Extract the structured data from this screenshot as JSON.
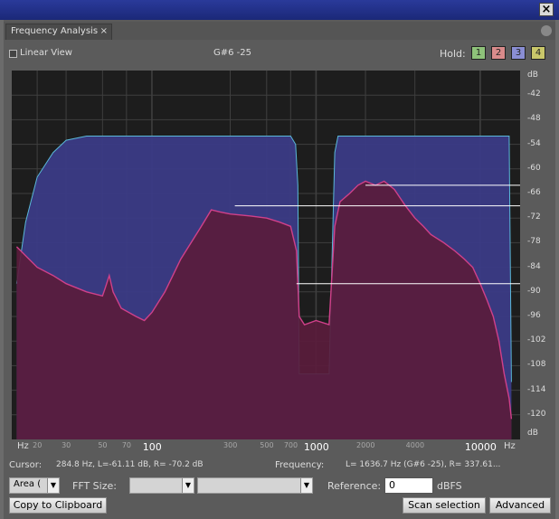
{
  "window": {
    "close_glyph": "×"
  },
  "tab": {
    "title": "Frequency Analysis",
    "close_glyph": "×"
  },
  "toolbar": {
    "linear_view_label": "Linear View",
    "linear_view_checked": false,
    "note_label": "G#6 -25",
    "hold_label": "Hold:",
    "hold_buttons": [
      {
        "label": "1",
        "color": "#8ec27a"
      },
      {
        "label": "2",
        "color": "#d98b8b"
      },
      {
        "label": "3",
        "color": "#8a8ed4"
      },
      {
        "label": "4",
        "color": "#c9c76a"
      }
    ]
  },
  "chart_data": {
    "type": "area",
    "x_scale": "log",
    "x_tick_labels": [
      "Hz",
      "20",
      "30",
      "50",
      "70",
      "100",
      "300",
      "500",
      "700",
      "1000",
      "2000",
      "4000",
      "10000",
      "Hz"
    ],
    "y_tick_labels": [
      "dB",
      "-42",
      "-48",
      "-54",
      "-60",
      "-66",
      "-72",
      "-78",
      "-84",
      "-90",
      "-96",
      "-102",
      "-108",
      "-114",
      "-120",
      "dB"
    ],
    "ylim": [
      -126,
      -36
    ],
    "grid": true,
    "colors": {
      "hold_fill": "#3b3b86",
      "hold_edge": "#5ab8d8",
      "spectrum_fill": "#5a1c3c",
      "spectrum_edge": "#d0408a",
      "grid": "#3f3f3f",
      "marker": "#ffffff"
    },
    "series": [
      {
        "role": "hold-overlay",
        "points": [
          [
            15,
            -88
          ],
          [
            17,
            -73
          ],
          [
            20,
            -62
          ],
          [
            25,
            -56
          ],
          [
            30,
            -53
          ],
          [
            40,
            -52
          ],
          [
            700,
            -52
          ],
          [
            750,
            -54
          ],
          [
            775,
            -64
          ],
          [
            790,
            -110
          ],
          [
            1200,
            -110
          ],
          [
            1300,
            -56
          ],
          [
            1360,
            -52
          ],
          [
            15000,
            -52
          ],
          [
            15500,
            -112
          ]
        ]
      },
      {
        "role": "spectrum",
        "points": [
          [
            15,
            -79
          ],
          [
            20,
            -84
          ],
          [
            25,
            -86
          ],
          [
            30,
            -88
          ],
          [
            40,
            -90
          ],
          [
            50,
            -91
          ],
          [
            52,
            -89
          ],
          [
            55,
            -86
          ],
          [
            58,
            -90
          ],
          [
            65,
            -94
          ],
          [
            80,
            -96
          ],
          [
            90,
            -97
          ],
          [
            100,
            -95
          ],
          [
            120,
            -90
          ],
          [
            150,
            -82
          ],
          [
            200,
            -74
          ],
          [
            230,
            -70
          ],
          [
            260,
            -70.5
          ],
          [
            300,
            -71
          ],
          [
            400,
            -71.5
          ],
          [
            500,
            -72
          ],
          [
            600,
            -73
          ],
          [
            700,
            -74
          ],
          [
            760,
            -80
          ],
          [
            790,
            -96
          ],
          [
            850,
            -98
          ],
          [
            1000,
            -97
          ],
          [
            1200,
            -98
          ],
          [
            1300,
            -74
          ],
          [
            1400,
            -68
          ],
          [
            1600,
            -66
          ],
          [
            1800,
            -64
          ],
          [
            2000,
            -63
          ],
          [
            2300,
            -64
          ],
          [
            2600,
            -63
          ],
          [
            3000,
            -65
          ],
          [
            3500,
            -69
          ],
          [
            4000,
            -72
          ],
          [
            4500,
            -74
          ],
          [
            5000,
            -76
          ],
          [
            6000,
            -78
          ],
          [
            7000,
            -80
          ],
          [
            8000,
            -82
          ],
          [
            9000,
            -84
          ],
          [
            10000,
            -88
          ],
          [
            11000,
            -92
          ],
          [
            12000,
            -96
          ],
          [
            13000,
            -102
          ],
          [
            14000,
            -110
          ],
          [
            15000,
            -116
          ],
          [
            15500,
            -121
          ]
        ]
      }
    ],
    "peak_markers": [
      {
        "x_start": 2000,
        "level": -64
      },
      {
        "x_start": 320,
        "level": -69
      },
      {
        "x_start": 760,
        "level": -88
      }
    ]
  },
  "readout": {
    "cursor_label": "Cursor:",
    "cursor_value": "284.8 Hz, L=-61.11 dB, R= -70.2 dB",
    "frequency_label": "Frequency:",
    "frequency_value": "L= 1636.7 Hz (G#6 -25), R= 337.61..."
  },
  "controls": {
    "area_label": "Area (",
    "fft_label": "FFT Size:",
    "reference_label": "Reference:",
    "reference_value": "0",
    "dbfs_label": "dBFS",
    "copy_label": "Copy to Clipboard",
    "scan_label": "Scan selection",
    "advanced_label": "Advanced"
  }
}
